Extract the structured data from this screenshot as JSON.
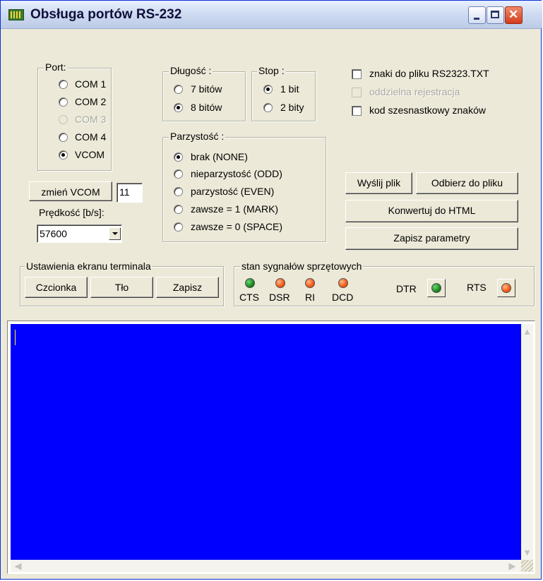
{
  "window": {
    "title": "Obsługa portów RS-232"
  },
  "port_group": {
    "legend": "Port:",
    "options": [
      {
        "label": "COM 1",
        "selected": false,
        "enabled": true
      },
      {
        "label": "COM 2",
        "selected": false,
        "enabled": true
      },
      {
        "label": "COM 3",
        "selected": false,
        "enabled": false
      },
      {
        "label": "COM 4",
        "selected": false,
        "enabled": true
      },
      {
        "label": "VCOM",
        "selected": true,
        "enabled": true
      }
    ]
  },
  "vcom": {
    "button_label": "zmień VCOM",
    "value": "11"
  },
  "speed": {
    "label": "Prędkość [b/s]:",
    "value": "57600"
  },
  "length_group": {
    "legend": "Długość :",
    "options": [
      {
        "label": "7 bitów",
        "selected": false
      },
      {
        "label": "8 bitów",
        "selected": true
      }
    ]
  },
  "stop_group": {
    "legend": "Stop :",
    "options": [
      {
        "label": "1 bit",
        "selected": true
      },
      {
        "label": "2 bity",
        "selected": false
      }
    ]
  },
  "parity_group": {
    "legend": "Parzystość :",
    "options": [
      {
        "label": "brak (NONE)",
        "selected": true
      },
      {
        "label": "nieparzystość (ODD)",
        "selected": false
      },
      {
        "label": "parzystość (EVEN)",
        "selected": false
      },
      {
        "label": "zawsze = 1 (MARK)",
        "selected": false
      },
      {
        "label": "zawsze = 0 (SPACE)",
        "selected": false
      }
    ]
  },
  "checkboxes": [
    {
      "label": "znaki do pliku RS2323.TXT",
      "checked": false,
      "enabled": true
    },
    {
      "label": "oddzielna rejestracja",
      "checked": false,
      "enabled": false
    },
    {
      "label": "kod szesnastkowy znaków",
      "checked": false,
      "enabled": true
    }
  ],
  "actions": {
    "send_file": "Wyślij plik",
    "receive_file": "Odbierz do pliku",
    "convert_html": "Konwertuj do HTML",
    "save_params": "Zapisz parametry"
  },
  "terminal_settings": {
    "legend": "Ustawienia ekranu terminala",
    "font_button": "Czcionka",
    "background_button": "Tło",
    "save_button": "Zapisz"
  },
  "signals": {
    "legend": "stan sygnałów sprzętowych",
    "leds": [
      {
        "label": "CTS",
        "color": "#0c7a12"
      },
      {
        "label": "DSR",
        "color": "#f04a00"
      },
      {
        "label": "RI",
        "color": "#f04a00"
      },
      {
        "label": "DCD",
        "color": "#f04a00"
      }
    ],
    "dtr": {
      "label": "DTR",
      "color": "#0c7a12"
    },
    "rts": {
      "label": "RTS",
      "color": "#f04a00"
    }
  },
  "terminal": {
    "background_color": "#0000ff",
    "cursor_color": "#ffff00"
  }
}
